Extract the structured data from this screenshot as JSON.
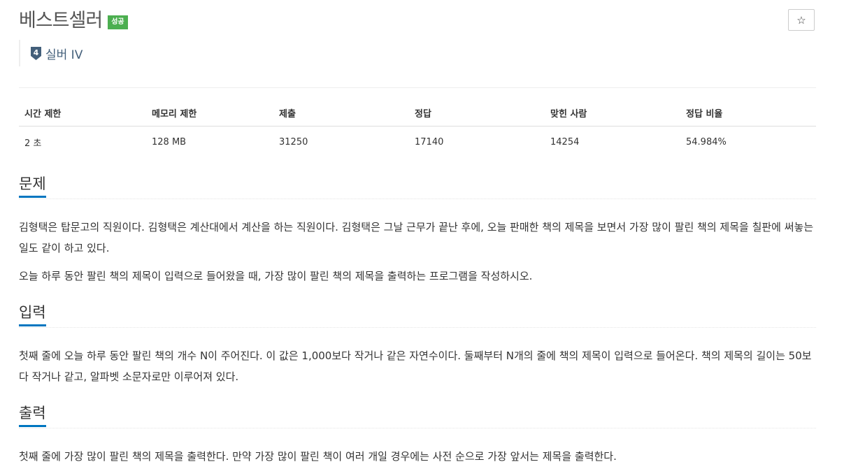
{
  "problem": {
    "title": "베스트셀러",
    "status_badge": "성공",
    "tier_label": "실버 IV",
    "tier_icon_number": "4",
    "star_icon": "☆"
  },
  "stats": {
    "headers": [
      "시간 제한",
      "메모리 제한",
      "제출",
      "정답",
      "맞힌 사람",
      "정답 비율"
    ],
    "values": [
      "2 초",
      "128 MB",
      "31250",
      "17140",
      "14254",
      "54.984%"
    ]
  },
  "sections": {
    "description": {
      "title": "문제",
      "paragraphs": [
        "김형택은 탑문고의 직원이다. 김형택은 계산대에서 계산을 하는 직원이다. 김형택은 그날 근무가 끝난 후에, 오늘 판매한 책의 제목을 보면서 가장 많이 팔린 책의 제목을 칠판에 써놓는 일도 같이 하고 있다.",
        "오늘 하루 동안 팔린 책의 제목이 입력으로 들어왔을 때, 가장 많이 팔린 책의 제목을 출력하는 프로그램을 작성하시오."
      ]
    },
    "input": {
      "title": "입력",
      "paragraphs": [
        "첫째 줄에 오늘 하루 동안 팔린 책의 개수 N이 주어진다. 이 값은 1,000보다 작거나 같은 자연수이다. 둘째부터 N개의 줄에 책의 제목이 입력으로 들어온다. 책의 제목의 길이는 50보다 작거나 같고, 알파벳 소문자로만 이루어져 있다."
      ]
    },
    "output": {
      "title": "출력",
      "paragraphs": [
        "첫째 줄에 가장 많이 팔린 책의 제목을 출력한다. 만약 가장 많이 팔린 책이 여러 개일 경우에는 사전 순으로 가장 앞서는 제목을 출력한다."
      ]
    }
  },
  "colors": {
    "badge_success": "#4caf50",
    "tier_silver": "#435f7a",
    "section_underline": "#0076c0"
  }
}
